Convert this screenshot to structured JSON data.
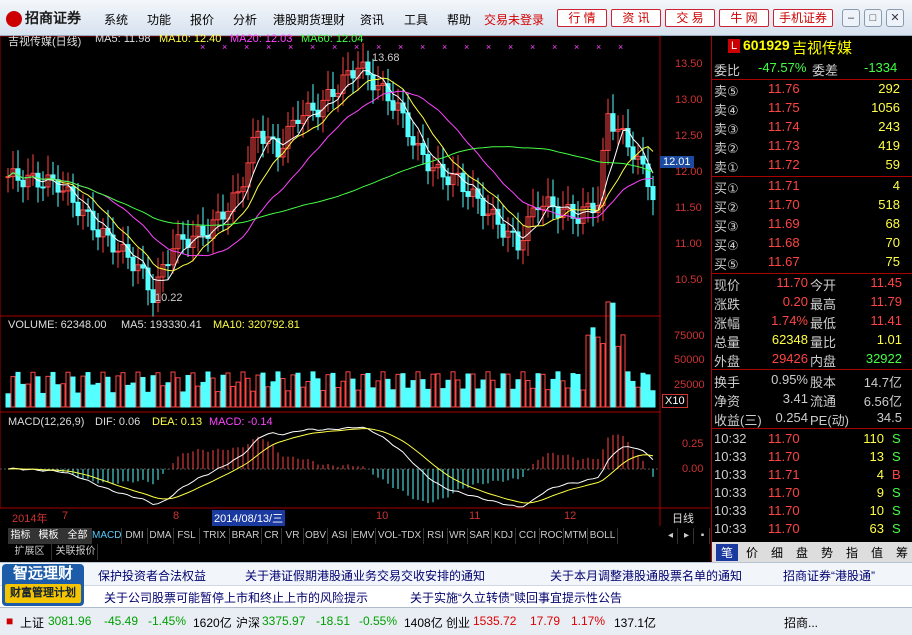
{
  "app": {
    "brand": "招商证券",
    "menus": [
      "系统",
      "功能",
      "报价",
      "分析",
      "港股期货理财",
      "资讯",
      "工具",
      "帮助"
    ],
    "login_status": "交易未登录",
    "quick_buttons": [
      "行 情",
      "资 讯",
      "交 易",
      "牛 网",
      "手机证券"
    ]
  },
  "chart": {
    "title": "吉视传媒(日线)",
    "ma5": "MA5: 11.98",
    "ma10": "MA10: 12.40",
    "ma20": "MA20: 12.03",
    "ma60": "MA60: 12.04",
    "high_label": "13.68",
    "low_label": "10.22",
    "price_axis": [
      "13.50",
      "13.00",
      "12.50",
      "12.00",
      "11.50",
      "11.00",
      "10.50"
    ],
    "current_price_tag": "12.01",
    "volume_title": "VOLUME: 62348.00",
    "vol_ma5": "MA5: 193330.41",
    "vol_ma10": "MA10: 320792.81",
    "volume_axis": [
      "75000",
      "50000",
      "25000"
    ],
    "volume_unit": "X10",
    "macd_title": "MACD(12,26,9)",
    "macd_dif": "DIF: 0.06",
    "macd_dea": "DEA: 0.13",
    "macd_val": "MACD: -0.14",
    "macd_axis": [
      "0.25",
      "0.00"
    ],
    "date_axis": {
      "year": "2014年",
      "months": [
        "7",
        "8",
        "10",
        "11",
        "12"
      ],
      "cursor_date": "2014/08/13/三"
    },
    "period_label": "日线"
  },
  "indicator_tabs": [
    "指标",
    "模板",
    "全部",
    "MACD",
    "DMI",
    "DMA",
    "FSL",
    "TRIX",
    "BRAR",
    "CR",
    "VR",
    "OBV",
    "ASI",
    "EMV",
    "VOL-TDX",
    "RSI",
    "WR",
    "SAR",
    "KDJ",
    "CCI",
    "ROC",
    "MTM",
    "BOLL"
  ],
  "sub_tabs": [
    "扩展区",
    "关联报价"
  ],
  "quote": {
    "code": "601929",
    "name": "吉视传媒",
    "wb_label": "委比",
    "wb_value": "-47.57%",
    "wc_label": "委差",
    "wc_value": "-1334",
    "sells": [
      {
        "label": "卖⑤",
        "price": "11.76",
        "vol": "292"
      },
      {
        "label": "卖④",
        "price": "11.75",
        "vol": "1056"
      },
      {
        "label": "卖③",
        "price": "11.74",
        "vol": "243"
      },
      {
        "label": "卖②",
        "price": "11.73",
        "vol": "419"
      },
      {
        "label": "卖①",
        "price": "11.72",
        "vol": "59"
      }
    ],
    "buys": [
      {
        "label": "买①",
        "price": "11.71",
        "vol": "4"
      },
      {
        "label": "买②",
        "price": "11.70",
        "vol": "518"
      },
      {
        "label": "买③",
        "price": "11.69",
        "vol": "68"
      },
      {
        "label": "买④",
        "price": "11.68",
        "vol": "70"
      },
      {
        "label": "买⑤",
        "price": "11.67",
        "vol": "75"
      }
    ],
    "stats": [
      {
        "l1": "现价",
        "v1": "11.70",
        "l2": "今开",
        "v2": "11.45"
      },
      {
        "l1": "涨跌",
        "v1": "0.20",
        "l2": "最高",
        "v2": "11.79"
      },
      {
        "l1": "涨幅",
        "v1": "1.74%",
        "l2": "最低",
        "v2": "11.41"
      },
      {
        "l1": "总量",
        "v1": "62348",
        "l2": "量比",
        "v2": "1.01"
      },
      {
        "l1": "外盘",
        "v1": "29426",
        "l2": "内盘",
        "v2": "32922"
      }
    ],
    "stats2": [
      {
        "l1": "换手",
        "v1": "0.95%",
        "l2": "股本",
        "v2": "14.7亿"
      },
      {
        "l1": "净资",
        "v1": "3.41",
        "l2": "流通",
        "v2": "6.56亿"
      },
      {
        "l1": "收益(三)",
        "v1": "0.254",
        "l2": "PE(动)",
        "v2": "34.5"
      }
    ],
    "ticks": [
      {
        "t": "10:32",
        "p": "11.70",
        "v": "110",
        "s": "S"
      },
      {
        "t": "10:33",
        "p": "11.70",
        "v": "13",
        "s": "S"
      },
      {
        "t": "10:33",
        "p": "11.71",
        "v": "4",
        "s": "B"
      },
      {
        "t": "10:33",
        "p": "11.70",
        "v": "9",
        "s": "S"
      },
      {
        "t": "10:33",
        "p": "11.70",
        "v": "10",
        "s": "S"
      },
      {
        "t": "10:33",
        "p": "11.70",
        "v": "63",
        "s": "S"
      }
    ],
    "bottom_tabs": [
      "笔",
      "价",
      "细",
      "盘",
      "势",
      "指",
      "值",
      "筹"
    ]
  },
  "news": {
    "promo_line1": "智远理财",
    "promo_line2": "财富管理计划",
    "row1": [
      "保护投资者合法权益",
      "关于港证假期港股通业务交易交收安排的通知",
      "关于本月调整港股通股票名单的通知",
      "招商证券“港股通”"
    ],
    "row2": [
      "关于公司股票可能暂停上市和终止上市的风险提示",
      "关于实施“久立转债”赎回事宜提示性公告"
    ]
  },
  "status": {
    "sh_label": "上证",
    "sh_val": "3081.96",
    "sh_chg": "-45.49",
    "sh_pct": "-1.45%",
    "sh_amt": "1620亿",
    "hs_label": "沪深",
    "hs_val": "3375.97",
    "hs_chg": "-18.51",
    "hs_pct": "-0.55%",
    "hs_amt": "1408亿",
    "cy_label": "创业",
    "cy_val": "1535.72",
    "cy_chg": "17.79",
    "cy_pct": "1.17%",
    "cy_amt": "137.1亿",
    "broker": "招商..."
  }
}
